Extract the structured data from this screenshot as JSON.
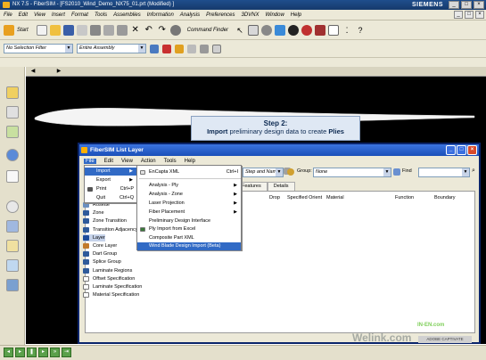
{
  "nx": {
    "title": "NX 7.5 - FiberSIM - [FS2010_Wind_Demo_NX75_01.prt (Modified) ]",
    "brand": "SIEMENS",
    "menu": [
      "File",
      "Edit",
      "View",
      "Insert",
      "Format",
      "Tools",
      "Assemblies",
      "Information",
      "Analysis",
      "Preferences",
      "3DVNX",
      "Window",
      "Help"
    ],
    "start_label": "Start",
    "command_finder": "Command Finder",
    "selection_filter": "No Selection Filter",
    "assembly_scope": "Entire Assembly"
  },
  "step": {
    "title": "Step 2:",
    "text_bold": "Import",
    "text_rest": " preliminary design data to create ",
    "text_end": "Plies"
  },
  "fibersim": {
    "title": "FiberSIM   List Layer",
    "menu": [
      "File",
      "Edit",
      "View",
      "Action",
      "Tools",
      "Help"
    ],
    "toolbar_combo1": "Step and Name",
    "group_label": "Group:",
    "group_value": "None",
    "find_label": "Find",
    "tabs": [
      "Features",
      "Details"
    ],
    "columns": [
      "Drop",
      "Specified Orient",
      "Material",
      "Function",
      "Boundary"
    ],
    "status_right": "ADOBE CAPTIVATE"
  },
  "file_menu": [
    {
      "label": "Import",
      "shortcut": "",
      "sub": true,
      "highlight": true
    },
    {
      "label": "Export",
      "shortcut": "",
      "sub": true,
      "highlight": false
    },
    {
      "label": "Print",
      "shortcut": "Ctrl+P",
      "sub": false,
      "highlight": false
    },
    {
      "label": "Quit",
      "shortcut": "Ctrl+Q",
      "sub": false,
      "highlight": false
    }
  ],
  "import_menu": [
    {
      "label": "EnCapta XML",
      "shortcut": "Ctrl+I",
      "sub": false,
      "highlight": false
    },
    {
      "label": "Analysis - Ply",
      "shortcut": "",
      "sub": true,
      "highlight": false
    },
    {
      "label": "Analysis - Zone",
      "shortcut": "",
      "sub": true,
      "highlight": false
    },
    {
      "label": "Laser Projection",
      "shortcut": "",
      "sub": true,
      "highlight": false
    },
    {
      "label": "Fiber Placement",
      "shortcut": "",
      "sub": true,
      "highlight": false
    },
    {
      "label": "Preliminary Design Interface",
      "shortcut": "",
      "sub": false,
      "highlight": false
    },
    {
      "label": "Ply Import from Excel",
      "shortcut": "",
      "sub": false,
      "highlight": false
    },
    {
      "label": "Composite Part XML",
      "shortcut": "",
      "sub": false,
      "highlight": false
    },
    {
      "label": "Wind Blade Design Import (Beta)",
      "shortcut": "",
      "sub": false,
      "highlight": true
    }
  ],
  "tree": [
    {
      "label": "Rosette",
      "icon_color": "#6a8fbf"
    },
    {
      "label": "Zone",
      "icon_color": "#2e5a9a"
    },
    {
      "label": "Zone Transition",
      "icon_color": "#2e5a9a"
    },
    {
      "label": "Transition Adjacency",
      "icon_color": "#2e5a9a"
    },
    {
      "label": "Layer",
      "icon_color": "#1d4b9a",
      "highlight": true
    },
    {
      "label": "Core Layer",
      "icon_color": "#c27a2a"
    },
    {
      "label": "Dart Group",
      "icon_color": "#2e5a9a"
    },
    {
      "label": "Splice Group",
      "icon_color": "#2e5a9a"
    },
    {
      "label": "Laminate Regions",
      "icon_color": "#2e5a9a"
    },
    {
      "label": "Offset Specification",
      "icon_color": "#ffffff"
    },
    {
      "label": "Laminate Specification",
      "icon_color": "#ffffff"
    },
    {
      "label": "Material Specification",
      "icon_color": "#ffffff"
    }
  ],
  "watermark": "Welink.com",
  "watermark_small": "IN-EN.com",
  "colors": {
    "accent": "#316ac5",
    "graphics_bg": "#000000",
    "titlebar": "#1a4fb8"
  }
}
